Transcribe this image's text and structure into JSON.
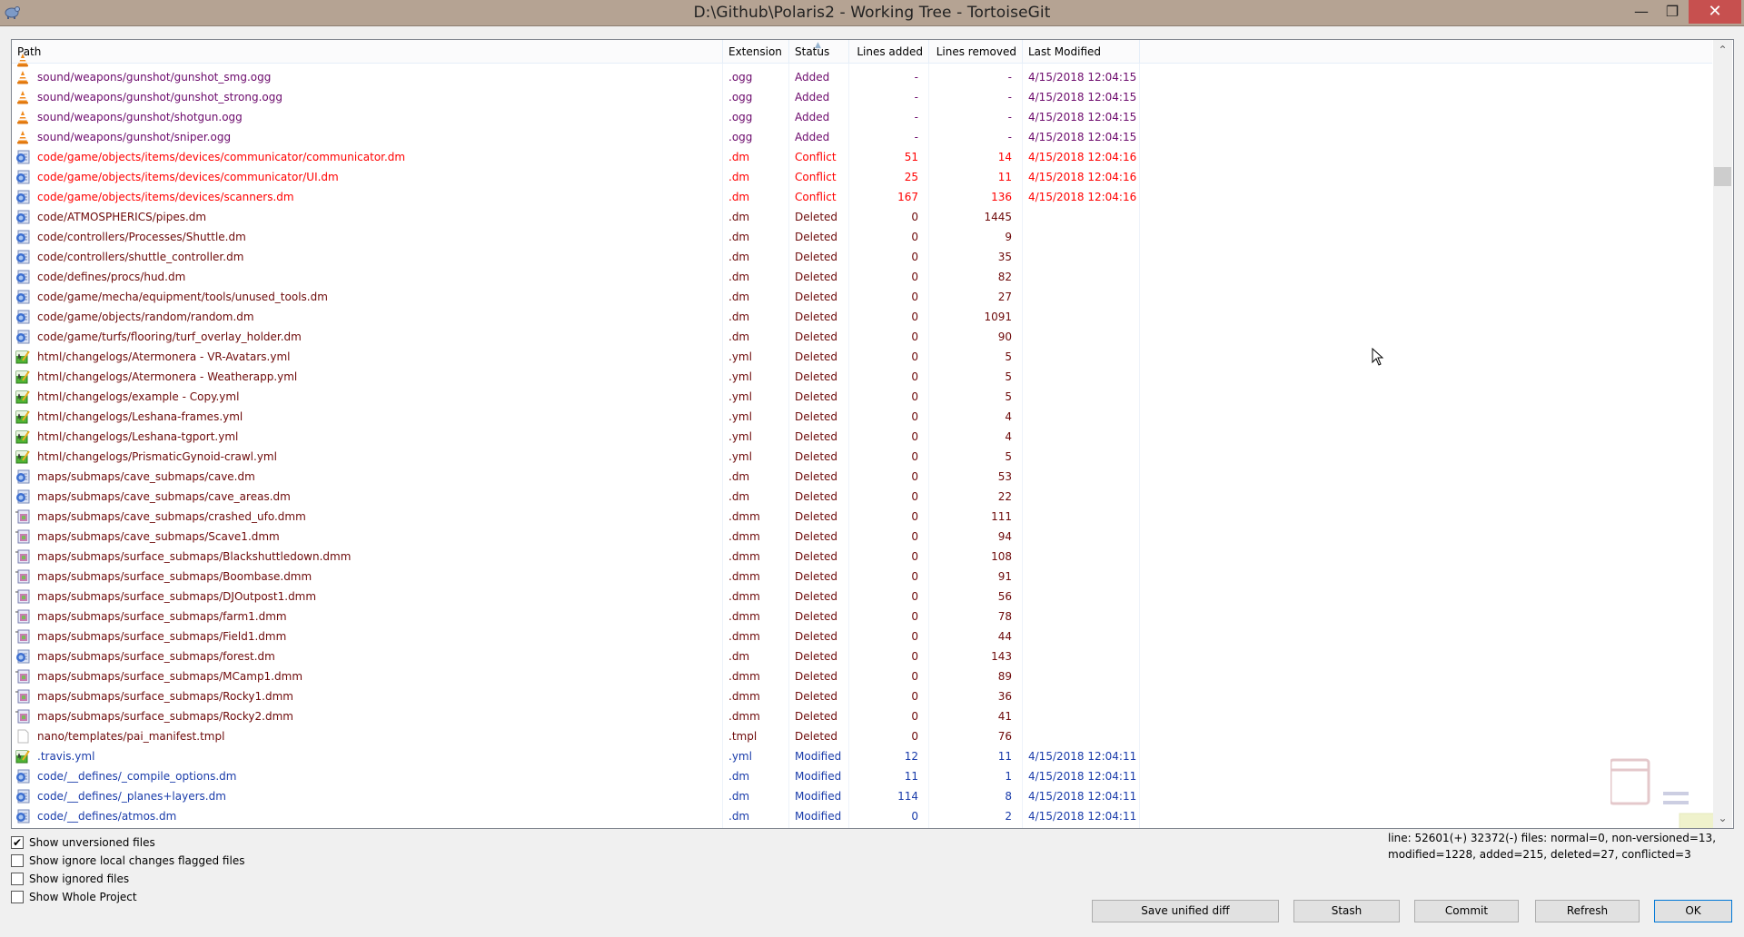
{
  "window": {
    "title": "D:\\Github\\Polaris2 - Working Tree - TortoiseGit",
    "controls": {
      "minimize": "—",
      "maximize": "❐",
      "close": "✕"
    }
  },
  "list": {
    "columns": {
      "path": "Path",
      "extension": "Extension",
      "status": "Status",
      "lines_added": "Lines added",
      "lines_removed": "Lines removed",
      "last_modified": "Last Modified"
    },
    "sort_indicator": "▲",
    "rows": [
      {
        "path": "sound/weapons/gunshot/gunshot_smg.ogg",
        "ext": ".ogg",
        "status": "Added",
        "added": "-",
        "removed": "-",
        "modified": "4/15/2018 12:04:15",
        "kind": "added",
        "icon": "audio-file-icon"
      },
      {
        "path": "sound/weapons/gunshot/gunshot_strong.ogg",
        "ext": ".ogg",
        "status": "Added",
        "added": "-",
        "removed": "-",
        "modified": "4/15/2018 12:04:15",
        "kind": "added",
        "icon": "audio-file-icon"
      },
      {
        "path": "sound/weapons/gunshot/shotgun.ogg",
        "ext": ".ogg",
        "status": "Added",
        "added": "-",
        "removed": "-",
        "modified": "4/15/2018 12:04:15",
        "kind": "added",
        "icon": "audio-file-icon"
      },
      {
        "path": "sound/weapons/gunshot/sniper.ogg",
        "ext": ".ogg",
        "status": "Added",
        "added": "-",
        "removed": "-",
        "modified": "4/15/2018 12:04:15",
        "kind": "added",
        "icon": "audio-file-icon"
      },
      {
        "path": "code/game/objects/items/devices/communicator/communicator.dm",
        "ext": ".dm",
        "status": "Conflict",
        "added": "51",
        "removed": "14",
        "modified": "4/15/2018 12:04:16",
        "kind": "conflict",
        "icon": "dm-file-icon"
      },
      {
        "path": "code/game/objects/items/devices/communicator/UI.dm",
        "ext": ".dm",
        "status": "Conflict",
        "added": "25",
        "removed": "11",
        "modified": "4/15/2018 12:04:16",
        "kind": "conflict",
        "icon": "dm-file-icon"
      },
      {
        "path": "code/game/objects/items/devices/scanners.dm",
        "ext": ".dm",
        "status": "Conflict",
        "added": "167",
        "removed": "136",
        "modified": "4/15/2018 12:04:16",
        "kind": "conflict",
        "icon": "dm-file-icon"
      },
      {
        "path": "code/ATMOSPHERICS/pipes.dm",
        "ext": ".dm",
        "status": "Deleted",
        "added": "0",
        "removed": "1445",
        "modified": "",
        "kind": "deleted",
        "icon": "dm-file-icon"
      },
      {
        "path": "code/controllers/Processes/Shuttle.dm",
        "ext": ".dm",
        "status": "Deleted",
        "added": "0",
        "removed": "9",
        "modified": "",
        "kind": "deleted",
        "icon": "dm-file-icon"
      },
      {
        "path": "code/controllers/shuttle_controller.dm",
        "ext": ".dm",
        "status": "Deleted",
        "added": "0",
        "removed": "35",
        "modified": "",
        "kind": "deleted",
        "icon": "dm-file-icon"
      },
      {
        "path": "code/defines/procs/hud.dm",
        "ext": ".dm",
        "status": "Deleted",
        "added": "0",
        "removed": "82",
        "modified": "",
        "kind": "deleted",
        "icon": "dm-file-icon"
      },
      {
        "path": "code/game/mecha/equipment/tools/unused_tools.dm",
        "ext": ".dm",
        "status": "Deleted",
        "added": "0",
        "removed": "27",
        "modified": "",
        "kind": "deleted",
        "icon": "dm-file-icon"
      },
      {
        "path": "code/game/objects/random/random.dm",
        "ext": ".dm",
        "status": "Deleted",
        "added": "0",
        "removed": "1091",
        "modified": "",
        "kind": "deleted",
        "icon": "dm-file-icon"
      },
      {
        "path": "code/game/turfs/flooring/turf_overlay_holder.dm",
        "ext": ".dm",
        "status": "Deleted",
        "added": "0",
        "removed": "90",
        "modified": "",
        "kind": "deleted",
        "icon": "dm-file-icon"
      },
      {
        "path": "html/changelogs/Atermonera - VR-Avatars.yml",
        "ext": ".yml",
        "status": "Deleted",
        "added": "0",
        "removed": "5",
        "modified": "",
        "kind": "deleted",
        "icon": "yml-file-icon"
      },
      {
        "path": "html/changelogs/Atermonera - Weatherapp.yml",
        "ext": ".yml",
        "status": "Deleted",
        "added": "0",
        "removed": "5",
        "modified": "",
        "kind": "deleted",
        "icon": "yml-file-icon"
      },
      {
        "path": "html/changelogs/example - Copy.yml",
        "ext": ".yml",
        "status": "Deleted",
        "added": "0",
        "removed": "5",
        "modified": "",
        "kind": "deleted",
        "icon": "yml-file-icon"
      },
      {
        "path": "html/changelogs/Leshana-frames.yml",
        "ext": ".yml",
        "status": "Deleted",
        "added": "0",
        "removed": "4",
        "modified": "",
        "kind": "deleted",
        "icon": "yml-file-icon"
      },
      {
        "path": "html/changelogs/Leshana-tgport.yml",
        "ext": ".yml",
        "status": "Deleted",
        "added": "0",
        "removed": "4",
        "modified": "",
        "kind": "deleted",
        "icon": "yml-file-icon"
      },
      {
        "path": "html/changelogs/PrismaticGynoid-crawl.yml",
        "ext": ".yml",
        "status": "Deleted",
        "added": "0",
        "removed": "5",
        "modified": "",
        "kind": "deleted",
        "icon": "yml-file-icon"
      },
      {
        "path": "maps/submaps/cave_submaps/cave.dm",
        "ext": ".dm",
        "status": "Deleted",
        "added": "0",
        "removed": "53",
        "modified": "",
        "kind": "deleted",
        "icon": "dm-file-icon"
      },
      {
        "path": "maps/submaps/cave_submaps/cave_areas.dm",
        "ext": ".dm",
        "status": "Deleted",
        "added": "0",
        "removed": "22",
        "modified": "",
        "kind": "deleted",
        "icon": "dm-file-icon"
      },
      {
        "path": "maps/submaps/cave_submaps/crashed_ufo.dmm",
        "ext": ".dmm",
        "status": "Deleted",
        "added": "0",
        "removed": "111",
        "modified": "",
        "kind": "deleted",
        "icon": "dmm-file-icon"
      },
      {
        "path": "maps/submaps/cave_submaps/Scave1.dmm",
        "ext": ".dmm",
        "status": "Deleted",
        "added": "0",
        "removed": "94",
        "modified": "",
        "kind": "deleted",
        "icon": "dmm-file-icon"
      },
      {
        "path": "maps/submaps/surface_submaps/Blackshuttledown.dmm",
        "ext": ".dmm",
        "status": "Deleted",
        "added": "0",
        "removed": "108",
        "modified": "",
        "kind": "deleted",
        "icon": "dmm-file-icon"
      },
      {
        "path": "maps/submaps/surface_submaps/Boombase.dmm",
        "ext": ".dmm",
        "status": "Deleted",
        "added": "0",
        "removed": "91",
        "modified": "",
        "kind": "deleted",
        "icon": "dmm-file-icon"
      },
      {
        "path": "maps/submaps/surface_submaps/DJOutpost1.dmm",
        "ext": ".dmm",
        "status": "Deleted",
        "added": "0",
        "removed": "56",
        "modified": "",
        "kind": "deleted",
        "icon": "dmm-file-icon"
      },
      {
        "path": "maps/submaps/surface_submaps/farm1.dmm",
        "ext": ".dmm",
        "status": "Deleted",
        "added": "0",
        "removed": "78",
        "modified": "",
        "kind": "deleted",
        "icon": "dmm-file-icon"
      },
      {
        "path": "maps/submaps/surface_submaps/Field1.dmm",
        "ext": ".dmm",
        "status": "Deleted",
        "added": "0",
        "removed": "44",
        "modified": "",
        "kind": "deleted",
        "icon": "dmm-file-icon"
      },
      {
        "path": "maps/submaps/surface_submaps/forest.dm",
        "ext": ".dm",
        "status": "Deleted",
        "added": "0",
        "removed": "143",
        "modified": "",
        "kind": "deleted",
        "icon": "dm-file-icon"
      },
      {
        "path": "maps/submaps/surface_submaps/MCamp1.dmm",
        "ext": ".dmm",
        "status": "Deleted",
        "added": "0",
        "removed": "89",
        "modified": "",
        "kind": "deleted",
        "icon": "dmm-file-icon"
      },
      {
        "path": "maps/submaps/surface_submaps/Rocky1.dmm",
        "ext": ".dmm",
        "status": "Deleted",
        "added": "0",
        "removed": "36",
        "modified": "",
        "kind": "deleted",
        "icon": "dmm-file-icon"
      },
      {
        "path": "maps/submaps/surface_submaps/Rocky2.dmm",
        "ext": ".dmm",
        "status": "Deleted",
        "added": "0",
        "removed": "41",
        "modified": "",
        "kind": "deleted",
        "icon": "dmm-file-icon"
      },
      {
        "path": "nano/templates/pai_manifest.tmpl",
        "ext": ".tmpl",
        "status": "Deleted",
        "added": "0",
        "removed": "76",
        "modified": "",
        "kind": "deleted",
        "icon": "blank-file-icon"
      },
      {
        "path": ".travis.yml",
        "ext": ".yml",
        "status": "Modified",
        "added": "12",
        "removed": "11",
        "modified": "4/15/2018 12:04:11",
        "kind": "modified",
        "icon": "yml-file-icon"
      },
      {
        "path": "code/__defines/_compile_options.dm",
        "ext": ".dm",
        "status": "Modified",
        "added": "11",
        "removed": "1",
        "modified": "4/15/2018 12:04:11",
        "kind": "modified",
        "icon": "dm-file-icon"
      },
      {
        "path": "code/__defines/_planes+layers.dm",
        "ext": ".dm",
        "status": "Modified",
        "added": "114",
        "removed": "8",
        "modified": "4/15/2018 12:04:11",
        "kind": "modified",
        "icon": "dm-file-icon"
      },
      {
        "path": "code/__defines/atmos.dm",
        "ext": ".dm",
        "status": "Modified",
        "added": "0",
        "removed": "2",
        "modified": "4/15/2018 12:04:11",
        "kind": "modified",
        "icon": "dm-file-icon"
      }
    ],
    "scroll": {
      "up": "⌃",
      "down": "⌄"
    }
  },
  "options": [
    {
      "label": "Show unversioned files",
      "checked": true
    },
    {
      "label": "Show ignore local changes flagged files",
      "checked": false
    },
    {
      "label": "Show ignored files",
      "checked": false
    },
    {
      "label": "Show Whole Project",
      "checked": false
    }
  ],
  "summary": {
    "line1": "line: 52601(+) 32372(-) files: normal=0, non-versioned=13,",
    "line2": "modified=1228, added=215, deleted=27, conflicted=3"
  },
  "buttons": {
    "save_diff": "Save unified diff",
    "stash": "Stash",
    "commit": "Commit",
    "refresh": "Refresh",
    "ok": "OK"
  },
  "colors": {
    "added": "#6c0a6c",
    "conflict": "#ff0000",
    "deleted": "#6e0a0a",
    "modified": "#1a3caa",
    "titlebar": "#b5a393",
    "close": "#c7504f"
  }
}
